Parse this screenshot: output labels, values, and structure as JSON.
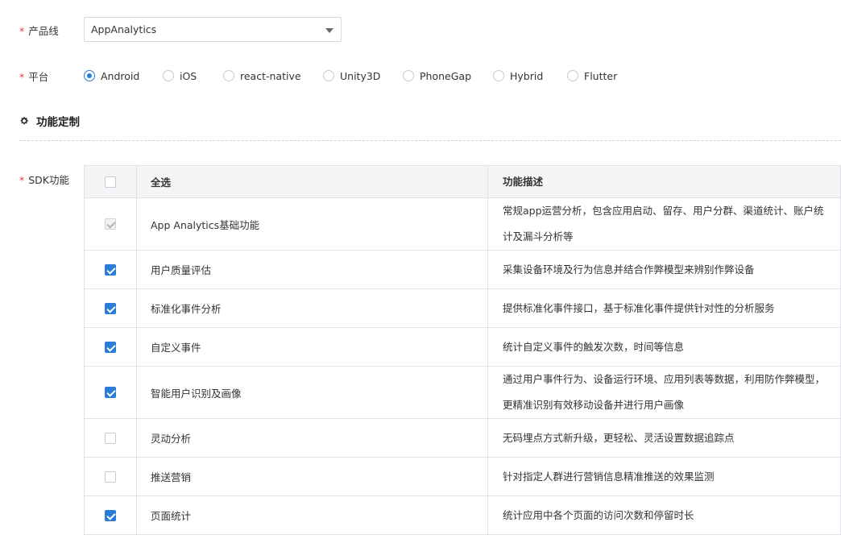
{
  "form": {
    "product_line": {
      "label": "产品线",
      "required_mark": "*",
      "value": "AppAnalytics"
    },
    "platform": {
      "label": "平台",
      "required_mark": "*",
      "options": [
        "Android",
        "iOS",
        "react-native",
        "Unity3D",
        "PhoneGap",
        "Hybrid",
        "Flutter"
      ],
      "selected": "Android"
    }
  },
  "section": {
    "title": "功能定制",
    "icon": "gear-icon"
  },
  "sdk": {
    "label": "SDK功能",
    "required_mark": "*",
    "columns": {
      "name": "全选",
      "desc": "功能描述"
    },
    "select_all_checked": false,
    "rows": [
      {
        "name": "App Analytics基础功能",
        "desc": "常规app运营分析，包含应用启动、留存、用户分群、渠道统计、账户统计及漏斗分析等",
        "state": "disabled"
      },
      {
        "name": "用户质量评估",
        "desc": "采集设备环境及行为信息并结合作弊模型来辨别作弊设备",
        "state": "checked"
      },
      {
        "name": "标准化事件分析",
        "desc": "提供标准化事件接口，基于标准化事件提供针对性的分析服务",
        "state": "checked"
      },
      {
        "name": "自定义事件",
        "desc": "统计自定义事件的触发次数，时间等信息",
        "state": "checked"
      },
      {
        "name": "智能用户识别及画像",
        "desc": "通过用户事件行为、设备运行环境、应用列表等数据，利用防作弊模型，更精准识别有效移动设备并进行用户画像",
        "state": "checked"
      },
      {
        "name": "灵动分析",
        "desc": "无码埋点方式新升级，更轻松、灵活设置数据追踪点",
        "state": "unchecked"
      },
      {
        "name": "推送营销",
        "desc": "针对指定人群进行营销信息精准推送的效果监测",
        "state": "unchecked"
      },
      {
        "name": "页面统计",
        "desc": "统计应用中各个页面的访问次数和停留时长",
        "state": "checked"
      }
    ]
  },
  "colors": {
    "accent": "#2b7bd9",
    "required": "#e6393d",
    "header_bg": "#f4f5f7",
    "border": "#dfe2e6"
  }
}
